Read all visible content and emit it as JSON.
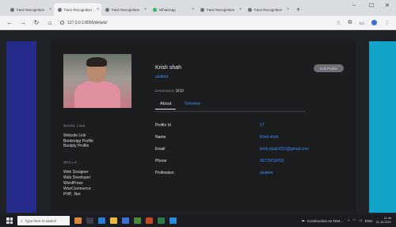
{
  "browser": {
    "tabs": [
      {
        "label": "Face Recognition",
        "active": false,
        "icon": "globe-icon"
      },
      {
        "label": "Face Recognition",
        "active": true,
        "icon": "globe-icon"
      },
      {
        "label": "Face Recognition",
        "active": false,
        "icon": "globe-icon"
      },
      {
        "label": "WhatsApp",
        "active": false,
        "icon": "whatsapp-icon"
      },
      {
        "label": "Face Recognition",
        "active": false,
        "icon": "globe-icon"
      },
      {
        "label": "Face Recognition",
        "active": false,
        "icon": "globe-icon"
      }
    ],
    "url": "127.0.0.1:8000/details/"
  },
  "profile": {
    "name": "Krish shah",
    "role": "student",
    "edit_label": "Edit Profile",
    "rankings_label": "RANKINGS:",
    "rankings_value": "9/10",
    "work_heading": "WORK LINK",
    "links": [
      "Website Link",
      "Bootsnipp Profile",
      "Bootply Profile"
    ],
    "skills_heading": "SKILLS",
    "skills": [
      "Web Designer",
      "Web Developer",
      "WordPress",
      "WooCommerce",
      "PHP, .Net"
    ],
    "tabs": {
      "about": "About",
      "timeline": "Timeline"
    },
    "fields": [
      {
        "label": "Profile Id",
        "value": "17"
      },
      {
        "label": "Name",
        "value": "Krish shah"
      },
      {
        "label": "Email",
        "value": "krish.shah1012@gmail.com"
      },
      {
        "label": "Phone",
        "value": "08779718702"
      },
      {
        "label": "Profession",
        "value": "student"
      }
    ]
  },
  "taskbar": {
    "search_placeholder": "Type here to search",
    "news": "Construction on NH4...",
    "lang": "ENG",
    "time": "11:46",
    "date": "21-10-2021"
  },
  "colors": {
    "accent": "#3d8cff",
    "left_panel": "#272b8c",
    "right_panel": "#12a3c9"
  }
}
